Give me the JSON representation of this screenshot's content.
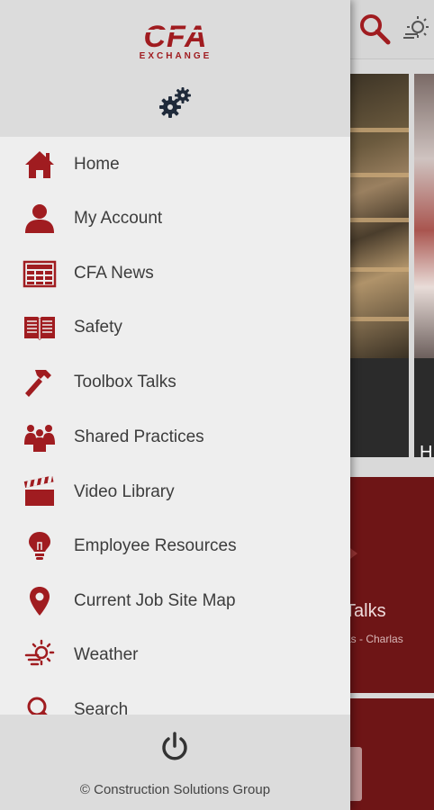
{
  "app": {
    "logo_main": "CFA",
    "logo_sub": "EXCHANGE",
    "brand_color": "#a01c20"
  },
  "header_icons": {
    "settings": "gears-icon",
    "search": "search-icon",
    "weather": "weather-icon"
  },
  "menu": {
    "items": [
      {
        "label": "Home",
        "icon": "home-icon"
      },
      {
        "label": "My Account",
        "icon": "user-icon"
      },
      {
        "label": "CFA News",
        "icon": "newspaper-icon"
      },
      {
        "label": "Safety",
        "icon": "book-icon"
      },
      {
        "label": "Toolbox Talks",
        "icon": "hammer-icon"
      },
      {
        "label": "Shared Practices",
        "icon": "people-icon"
      },
      {
        "label": " Video Library",
        "icon": "clapperboard-icon"
      },
      {
        "label": "Employee Resources",
        "icon": "lightbulb-icon"
      },
      {
        "label": "Current Job Site Map",
        "icon": "map-pin-icon"
      },
      {
        "label": "Weather",
        "icon": "weather-icon"
      },
      {
        "label": "Search",
        "icon": "search-icon"
      }
    ]
  },
  "footer": {
    "power_icon": "power-icon",
    "copyright": "© Construction Solutions Group"
  },
  "background": {
    "tile2_letter": "H",
    "talks_title": "Talks",
    "talks_subtitle": "as - Charlas",
    "maroon_color": "#6e1516"
  }
}
